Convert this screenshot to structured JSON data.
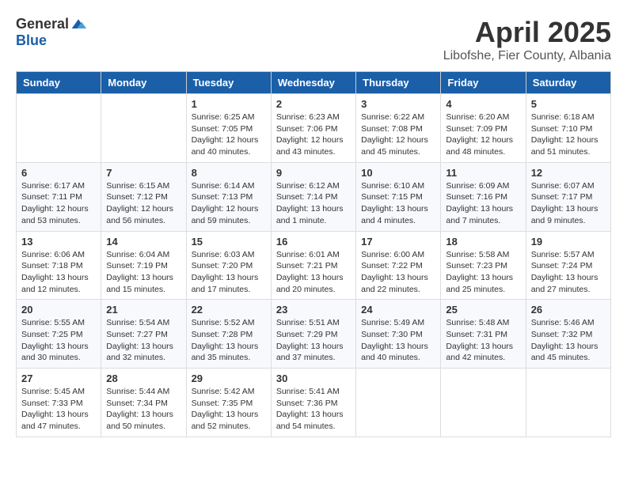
{
  "logo": {
    "general": "General",
    "blue": "Blue"
  },
  "title": "April 2025",
  "subtitle": "Libofshe, Fier County, Albania",
  "days_of_week": [
    "Sunday",
    "Monday",
    "Tuesday",
    "Wednesday",
    "Thursday",
    "Friday",
    "Saturday"
  ],
  "weeks": [
    [
      {
        "day": "",
        "content": ""
      },
      {
        "day": "",
        "content": ""
      },
      {
        "day": "1",
        "content": "Sunrise: 6:25 AM\nSunset: 7:05 PM\nDaylight: 12 hours and 40 minutes."
      },
      {
        "day": "2",
        "content": "Sunrise: 6:23 AM\nSunset: 7:06 PM\nDaylight: 12 hours and 43 minutes."
      },
      {
        "day": "3",
        "content": "Sunrise: 6:22 AM\nSunset: 7:08 PM\nDaylight: 12 hours and 45 minutes."
      },
      {
        "day": "4",
        "content": "Sunrise: 6:20 AM\nSunset: 7:09 PM\nDaylight: 12 hours and 48 minutes."
      },
      {
        "day": "5",
        "content": "Sunrise: 6:18 AM\nSunset: 7:10 PM\nDaylight: 12 hours and 51 minutes."
      }
    ],
    [
      {
        "day": "6",
        "content": "Sunrise: 6:17 AM\nSunset: 7:11 PM\nDaylight: 12 hours and 53 minutes."
      },
      {
        "day": "7",
        "content": "Sunrise: 6:15 AM\nSunset: 7:12 PM\nDaylight: 12 hours and 56 minutes."
      },
      {
        "day": "8",
        "content": "Sunrise: 6:14 AM\nSunset: 7:13 PM\nDaylight: 12 hours and 59 minutes."
      },
      {
        "day": "9",
        "content": "Sunrise: 6:12 AM\nSunset: 7:14 PM\nDaylight: 13 hours and 1 minute."
      },
      {
        "day": "10",
        "content": "Sunrise: 6:10 AM\nSunset: 7:15 PM\nDaylight: 13 hours and 4 minutes."
      },
      {
        "day": "11",
        "content": "Sunrise: 6:09 AM\nSunset: 7:16 PM\nDaylight: 13 hours and 7 minutes."
      },
      {
        "day": "12",
        "content": "Sunrise: 6:07 AM\nSunset: 7:17 PM\nDaylight: 13 hours and 9 minutes."
      }
    ],
    [
      {
        "day": "13",
        "content": "Sunrise: 6:06 AM\nSunset: 7:18 PM\nDaylight: 13 hours and 12 minutes."
      },
      {
        "day": "14",
        "content": "Sunrise: 6:04 AM\nSunset: 7:19 PM\nDaylight: 13 hours and 15 minutes."
      },
      {
        "day": "15",
        "content": "Sunrise: 6:03 AM\nSunset: 7:20 PM\nDaylight: 13 hours and 17 minutes."
      },
      {
        "day": "16",
        "content": "Sunrise: 6:01 AM\nSunset: 7:21 PM\nDaylight: 13 hours and 20 minutes."
      },
      {
        "day": "17",
        "content": "Sunrise: 6:00 AM\nSunset: 7:22 PM\nDaylight: 13 hours and 22 minutes."
      },
      {
        "day": "18",
        "content": "Sunrise: 5:58 AM\nSunset: 7:23 PM\nDaylight: 13 hours and 25 minutes."
      },
      {
        "day": "19",
        "content": "Sunrise: 5:57 AM\nSunset: 7:24 PM\nDaylight: 13 hours and 27 minutes."
      }
    ],
    [
      {
        "day": "20",
        "content": "Sunrise: 5:55 AM\nSunset: 7:25 PM\nDaylight: 13 hours and 30 minutes."
      },
      {
        "day": "21",
        "content": "Sunrise: 5:54 AM\nSunset: 7:27 PM\nDaylight: 13 hours and 32 minutes."
      },
      {
        "day": "22",
        "content": "Sunrise: 5:52 AM\nSunset: 7:28 PM\nDaylight: 13 hours and 35 minutes."
      },
      {
        "day": "23",
        "content": "Sunrise: 5:51 AM\nSunset: 7:29 PM\nDaylight: 13 hours and 37 minutes."
      },
      {
        "day": "24",
        "content": "Sunrise: 5:49 AM\nSunset: 7:30 PM\nDaylight: 13 hours and 40 minutes."
      },
      {
        "day": "25",
        "content": "Sunrise: 5:48 AM\nSunset: 7:31 PM\nDaylight: 13 hours and 42 minutes."
      },
      {
        "day": "26",
        "content": "Sunrise: 5:46 AM\nSunset: 7:32 PM\nDaylight: 13 hours and 45 minutes."
      }
    ],
    [
      {
        "day": "27",
        "content": "Sunrise: 5:45 AM\nSunset: 7:33 PM\nDaylight: 13 hours and 47 minutes."
      },
      {
        "day": "28",
        "content": "Sunrise: 5:44 AM\nSunset: 7:34 PM\nDaylight: 13 hours and 50 minutes."
      },
      {
        "day": "29",
        "content": "Sunrise: 5:42 AM\nSunset: 7:35 PM\nDaylight: 13 hours and 52 minutes."
      },
      {
        "day": "30",
        "content": "Sunrise: 5:41 AM\nSunset: 7:36 PM\nDaylight: 13 hours and 54 minutes."
      },
      {
        "day": "",
        "content": ""
      },
      {
        "day": "",
        "content": ""
      },
      {
        "day": "",
        "content": ""
      }
    ]
  ]
}
